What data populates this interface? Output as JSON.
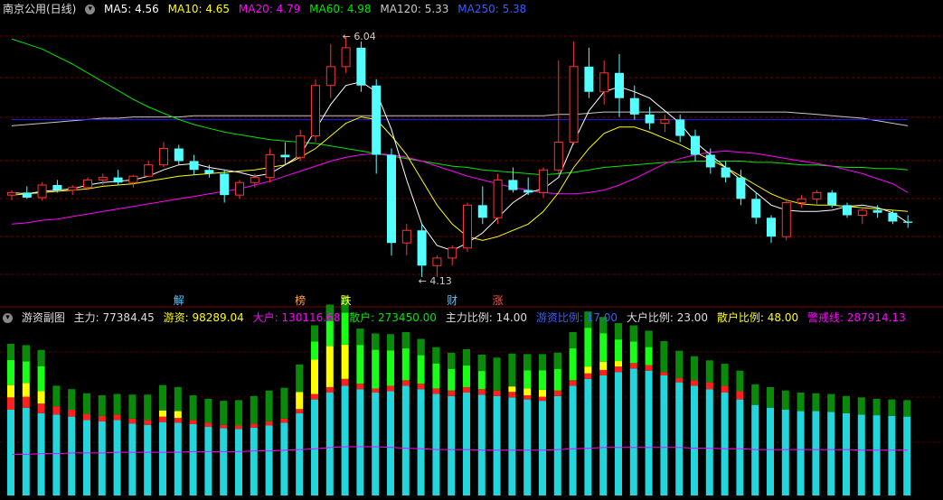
{
  "main_header": {
    "title": "南京公用(日线)",
    "ma5": "MA5: 4.56",
    "ma10": "MA10: 4.65",
    "ma20": "MA20: 4.79",
    "ma60": "MA60: 4.98",
    "ma120": "MA120: 5.33",
    "ma250": "MA250: 5.38"
  },
  "colors": {
    "up": "#ff3232",
    "down": "#54ffff",
    "ma5": "#ffffff",
    "ma10": "#ffff00",
    "ma20": "#ff00ff",
    "ma60": "#00e600",
    "ma120": "#c8c8c8",
    "ma250": "#1e1eff",
    "green_dark": "#0a8a0a",
    "green_bright": "#18ff18",
    "yellow": "#ffff00",
    "red": "#ff2020",
    "cyan": "#22d6dc",
    "warn": "#ff00ff"
  },
  "events": [
    {
      "label": "解",
      "color": "#54c8ff",
      "index": 11
    },
    {
      "label": "榜",
      "color": "#ffa040",
      "index": 19
    },
    {
      "label": "跌",
      "color": "#ffff40",
      "index": 22
    },
    {
      "label": "财",
      "color": "#54c8ff",
      "index": 29
    },
    {
      "label": "涨",
      "color": "#ff5050",
      "index": 32
    }
  ],
  "annotations": {
    "high": "6.04",
    "low": "4.13"
  },
  "sub_header": {
    "title": "游资副图",
    "main": "主力: 77384.45",
    "hot": "游资: 98289.04",
    "big": "大户: 130116.68",
    "retail": "散户: 273450.00",
    "main_ratio": "主力比例: 14.00",
    "hot_ratio": "游资比例: 17.00",
    "big_ratio": "大户比例: 23.00",
    "retail_ratio": "散户比例: 48.00",
    "warn": "警戒线: 287914.13"
  },
  "chart_data": [
    {
      "type": "candlestick",
      "title": "南京公用(日线)",
      "ylim": [
        4.0,
        6.2
      ],
      "candles": [
        [
          4.78,
          4.82,
          4.74,
          4.8
        ],
        [
          4.8,
          4.85,
          4.75,
          4.76
        ],
        [
          4.76,
          4.88,
          4.74,
          4.86
        ],
        [
          4.86,
          4.9,
          4.8,
          4.82
        ],
        [
          4.82,
          4.86,
          4.78,
          4.84
        ],
        [
          4.84,
          4.92,
          4.82,
          4.9
        ],
        [
          4.9,
          4.95,
          4.86,
          4.92
        ],
        [
          4.92,
          4.98,
          4.86,
          4.88
        ],
        [
          4.88,
          4.94,
          4.84,
          4.93
        ],
        [
          4.93,
          5.05,
          4.92,
          5.02
        ],
        [
          5.02,
          5.2,
          5.0,
          5.15
        ],
        [
          5.15,
          5.18,
          5.02,
          5.05
        ],
        [
          5.05,
          5.1,
          4.94,
          4.98
        ],
        [
          4.98,
          5.02,
          4.92,
          4.95
        ],
        [
          4.95,
          4.98,
          4.72,
          4.78
        ],
        [
          4.78,
          4.9,
          4.75,
          4.88
        ],
        [
          4.88,
          4.95,
          4.84,
          4.92
        ],
        [
          4.92,
          5.15,
          4.88,
          5.1
        ],
        [
          5.1,
          5.2,
          5.02,
          5.08
        ],
        [
          5.08,
          5.3,
          5.05,
          5.25
        ],
        [
          5.25,
          5.7,
          5.2,
          5.65
        ],
        [
          5.65,
          5.98,
          5.55,
          5.8
        ],
        [
          5.8,
          6.04,
          5.75,
          5.95
        ],
        [
          5.95,
          6.0,
          5.6,
          5.65
        ],
        [
          5.65,
          5.7,
          4.95,
          5.1
        ],
        [
          5.1,
          5.15,
          4.3,
          4.4
        ],
        [
          4.4,
          4.55,
          4.3,
          4.5
        ],
        [
          4.5,
          4.55,
          4.13,
          4.22
        ],
        [
          4.22,
          4.3,
          4.13,
          4.28
        ],
        [
          4.28,
          4.38,
          4.22,
          4.36
        ],
        [
          4.36,
          4.72,
          4.33,
          4.7
        ],
        [
          4.7,
          4.85,
          4.55,
          4.6
        ],
        [
          4.6,
          4.95,
          4.55,
          4.9
        ],
        [
          4.9,
          5.0,
          4.8,
          4.82
        ],
        [
          4.82,
          4.92,
          4.78,
          4.8
        ],
        [
          4.8,
          5.0,
          4.76,
          4.98
        ],
        [
          4.98,
          5.85,
          4.95,
          5.2
        ],
        [
          5.2,
          6.0,
          5.18,
          5.8
        ],
        [
          5.8,
          5.95,
          5.55,
          5.6
        ],
        [
          5.6,
          5.85,
          5.5,
          5.75
        ],
        [
          5.75,
          5.9,
          5.4,
          5.55
        ],
        [
          5.55,
          5.65,
          5.38,
          5.42
        ],
        [
          5.42,
          5.48,
          5.3,
          5.35
        ],
        [
          5.35,
          5.42,
          5.28,
          5.38
        ],
        [
          5.38,
          5.42,
          5.2,
          5.25
        ],
        [
          5.25,
          5.3,
          5.05,
          5.1
        ],
        [
          5.1,
          5.15,
          4.95,
          5.0
        ],
        [
          5.0,
          5.05,
          4.88,
          4.92
        ],
        [
          4.92,
          4.98,
          4.7,
          4.75
        ],
        [
          4.75,
          4.8,
          4.55,
          4.6
        ],
        [
          4.6,
          4.62,
          4.4,
          4.45
        ],
        [
          4.45,
          4.75,
          4.42,
          4.72
        ],
        [
          4.72,
          4.78,
          4.68,
          4.75
        ],
        [
          4.75,
          4.82,
          4.7,
          4.8
        ],
        [
          4.8,
          4.82,
          4.68,
          4.7
        ],
        [
          4.7,
          4.72,
          4.6,
          4.62
        ],
        [
          4.62,
          4.68,
          4.55,
          4.66
        ],
        [
          4.66,
          4.7,
          4.6,
          4.64
        ],
        [
          4.64,
          4.66,
          4.55,
          4.57
        ],
        [
          4.57,
          4.62,
          4.52,
          4.56
        ]
      ],
      "ma_lines": [
        {
          "name": "MA120",
          "values": [
            5.33,
            5.34,
            5.35,
            5.36,
            5.37,
            5.38,
            5.39,
            5.39,
            5.4,
            5.4,
            5.4,
            5.4,
            5.41,
            5.41,
            5.41,
            5.41,
            5.41,
            5.41,
            5.41,
            5.41,
            5.41,
            5.41,
            5.41,
            5.41,
            5.41,
            5.41,
            5.41,
            5.41,
            5.41,
            5.41,
            5.41,
            5.41,
            5.41,
            5.41,
            5.41,
            5.41,
            5.42,
            5.42,
            5.43,
            5.44,
            5.44,
            5.44,
            5.44,
            5.44,
            5.44,
            5.44,
            5.44,
            5.44,
            5.44,
            5.44,
            5.44,
            5.44,
            5.43,
            5.42,
            5.41,
            5.4,
            5.39,
            5.37,
            5.35,
            5.33
          ]
        },
        {
          "name": "MA250",
          "values": [
            5.38,
            5.38,
            5.38,
            5.38,
            5.38,
            5.38,
            5.38,
            5.38,
            5.38,
            5.38,
            5.38,
            5.38,
            5.38,
            5.38,
            5.38,
            5.38,
            5.38,
            5.38,
            5.38,
            5.38,
            5.38,
            5.38,
            5.38,
            5.38,
            5.38,
            5.38,
            5.38,
            5.38,
            5.38,
            5.38,
            5.38,
            5.38,
            5.38,
            5.38,
            5.38,
            5.38,
            5.38,
            5.38,
            5.38,
            5.38,
            5.38,
            5.38,
            5.38,
            5.38,
            5.38,
            5.38,
            5.38,
            5.38,
            5.38,
            5.38,
            5.38,
            5.38,
            5.38,
            5.38,
            5.38,
            5.38,
            5.38,
            5.38,
            5.38,
            5.38
          ]
        },
        {
          "name": "MA60",
          "values": [
            6.02,
            5.98,
            5.94,
            5.88,
            5.82,
            5.75,
            5.68,
            5.61,
            5.54,
            5.48,
            5.43,
            5.38,
            5.34,
            5.31,
            5.28,
            5.26,
            5.24,
            5.22,
            5.21,
            5.2,
            5.19,
            5.17,
            5.15,
            5.13,
            5.11,
            5.09,
            5.07,
            5.05,
            5.03,
            5.01,
            5.0,
            4.98,
            4.97,
            4.96,
            4.95,
            4.94,
            4.95,
            4.96,
            4.98,
            5.0,
            5.01,
            5.02,
            5.03,
            5.04,
            5.04,
            5.05,
            5.05,
            5.05,
            5.05,
            5.04,
            5.04,
            5.03,
            5.02,
            5.02,
            5.01,
            5.0,
            5.0,
            4.99,
            4.99,
            4.98
          ]
        },
        {
          "name": "MA20",
          "values": [
            4.55,
            4.56,
            4.58,
            4.59,
            4.61,
            4.63,
            4.65,
            4.67,
            4.69,
            4.71,
            4.73,
            4.75,
            4.77,
            4.79,
            4.81,
            4.83,
            4.86,
            4.89,
            4.93,
            4.97,
            5.01,
            5.05,
            5.08,
            5.1,
            5.11,
            5.1,
            5.08,
            5.05,
            5.01,
            4.97,
            4.93,
            4.9,
            4.87,
            4.84,
            4.82,
            4.8,
            4.79,
            4.79,
            4.8,
            4.82,
            4.86,
            4.91,
            4.97,
            5.03,
            5.07,
            5.1,
            5.12,
            5.13,
            5.12,
            5.11,
            5.09,
            5.07,
            5.05,
            5.03,
            5.01,
            4.98,
            4.95,
            4.91,
            4.87,
            4.8
          ]
        },
        {
          "name": "MA10",
          "values": [
            4.78,
            4.79,
            4.8,
            4.81,
            4.82,
            4.83,
            4.85,
            4.86,
            4.87,
            4.89,
            4.91,
            4.93,
            4.94,
            4.95,
            4.96,
            4.97,
            4.98,
            5.0,
            5.02,
            5.08,
            5.15,
            5.25,
            5.35,
            5.4,
            5.38,
            5.25,
            5.1,
            4.9,
            4.7,
            4.55,
            4.45,
            4.42,
            4.45,
            4.5,
            4.55,
            4.65,
            4.8,
            5.0,
            5.15,
            5.27,
            5.32,
            5.32,
            5.28,
            5.23,
            5.18,
            5.12,
            5.06,
            5.0,
            4.93,
            4.86,
            4.79,
            4.74,
            4.71,
            4.7,
            4.7,
            4.69,
            4.68,
            4.67,
            4.66,
            4.65
          ]
        },
        {
          "name": "MA5",
          "values": [
            4.8,
            4.79,
            4.81,
            4.82,
            4.83,
            4.86,
            4.88,
            4.89,
            4.9,
            4.93,
            4.98,
            5.02,
            5.03,
            5.0,
            4.98,
            4.96,
            4.93,
            4.95,
            5.02,
            5.1,
            5.3,
            5.5,
            5.65,
            5.68,
            5.6,
            5.3,
            4.9,
            4.55,
            4.38,
            4.34,
            4.4,
            4.48,
            4.6,
            4.72,
            4.8,
            4.83,
            4.92,
            5.2,
            5.45,
            5.6,
            5.64,
            5.6,
            5.55,
            5.45,
            5.35,
            5.2,
            5.1,
            5.0,
            4.9,
            4.8,
            4.7,
            4.66,
            4.65,
            4.65,
            4.66,
            4.69,
            4.7,
            4.68,
            4.64,
            4.56
          ]
        }
      ]
    },
    {
      "type": "bar",
      "title": "游资副图",
      "categories_count": 60,
      "series_order": [
        "散户",
        "大户",
        "游资",
        "主力"
      ],
      "series": [
        {
          "name": "主力",
          "color": "#22d6dc",
          "values": [
            125,
            128,
            120,
            118,
            115,
            110,
            108,
            110,
            105,
            103,
            107,
            106,
            104,
            100,
            98,
            97,
            99,
            102,
            106,
            120,
            140,
            150,
            160,
            155,
            150,
            152,
            160,
            155,
            148,
            145,
            150,
            147,
            145,
            143,
            140,
            138,
            145,
            160,
            170,
            175,
            180,
            185,
            182,
            175,
            165,
            160,
            155,
            150,
            140,
            132,
            128,
            125,
            123,
            123,
            122,
            120,
            118,
            117,
            116,
            115
          ]
        },
        {
          "name": "大户",
          "color": "#ff2020",
          "values": [
            18,
            16,
            14,
            12,
            10,
            9,
            8,
            8,
            7,
            7,
            8,
            7,
            6,
            6,
            5,
            5,
            6,
            6,
            6,
            6,
            8,
            8,
            10,
            8,
            6,
            8,
            8,
            8,
            8,
            8,
            8,
            8,
            8,
            8,
            6,
            6,
            8,
            8,
            8,
            8,
            8,
            8,
            8,
            5,
            6,
            8,
            10,
            10,
            12,
            0,
            0,
            0,
            0,
            0,
            0,
            0,
            0,
            0,
            0,
            0
          ]
        },
        {
          "name": "游资",
          "color": "#ffff00",
          "values": [
            18,
            20,
            18,
            0,
            0,
            0,
            0,
            0,
            0,
            0,
            9,
            10,
            0,
            0,
            0,
            0,
            0,
            0,
            0,
            25,
            50,
            60,
            50,
            0,
            0,
            0,
            0,
            0,
            0,
            0,
            0,
            0,
            0,
            8,
            10,
            10,
            0,
            0,
            10,
            12,
            8,
            0,
            0,
            0,
            0,
            0,
            0,
            0,
            0,
            0,
            0,
            0,
            0,
            0,
            0,
            0,
            0,
            0,
            0,
            0
          ]
        },
        {
          "name": "散户",
          "color": "#0a8a0a",
          "values": [
            60,
            55,
            60,
            30,
            30,
            30,
            30,
            30,
            35,
            37,
            37,
            35,
            36,
            35,
            35,
            37,
            40,
            45,
            45,
            40,
            50,
            60,
            70,
            80,
            80,
            75,
            70,
            65,
            60,
            55,
            55,
            50,
            48,
            48,
            50,
            52,
            55,
            70,
            80,
            65,
            55,
            55,
            50,
            45,
            40,
            35,
            32,
            32,
            30,
            30,
            30,
            28,
            27,
            26,
            26,
            25,
            25,
            24,
            24,
            24
          ]
        },
        {
          "name": "警戒线",
          "color": "#ff00ff",
          "values": [
            60,
            60,
            61,
            61,
            62,
            62,
            62,
            63,
            63,
            63,
            63,
            63,
            64,
            64,
            64,
            64,
            65,
            65,
            66,
            67,
            68,
            70,
            71,
            71,
            71,
            70,
            69,
            68,
            67,
            67,
            67,
            66,
            66,
            66,
            66,
            66,
            67,
            68,
            69,
            70,
            70,
            70,
            70,
            70,
            70,
            69,
            69,
            68,
            68,
            67,
            67,
            67,
            67,
            67,
            67,
            67,
            66,
            66,
            66,
            66
          ]
        }
      ]
    }
  ]
}
